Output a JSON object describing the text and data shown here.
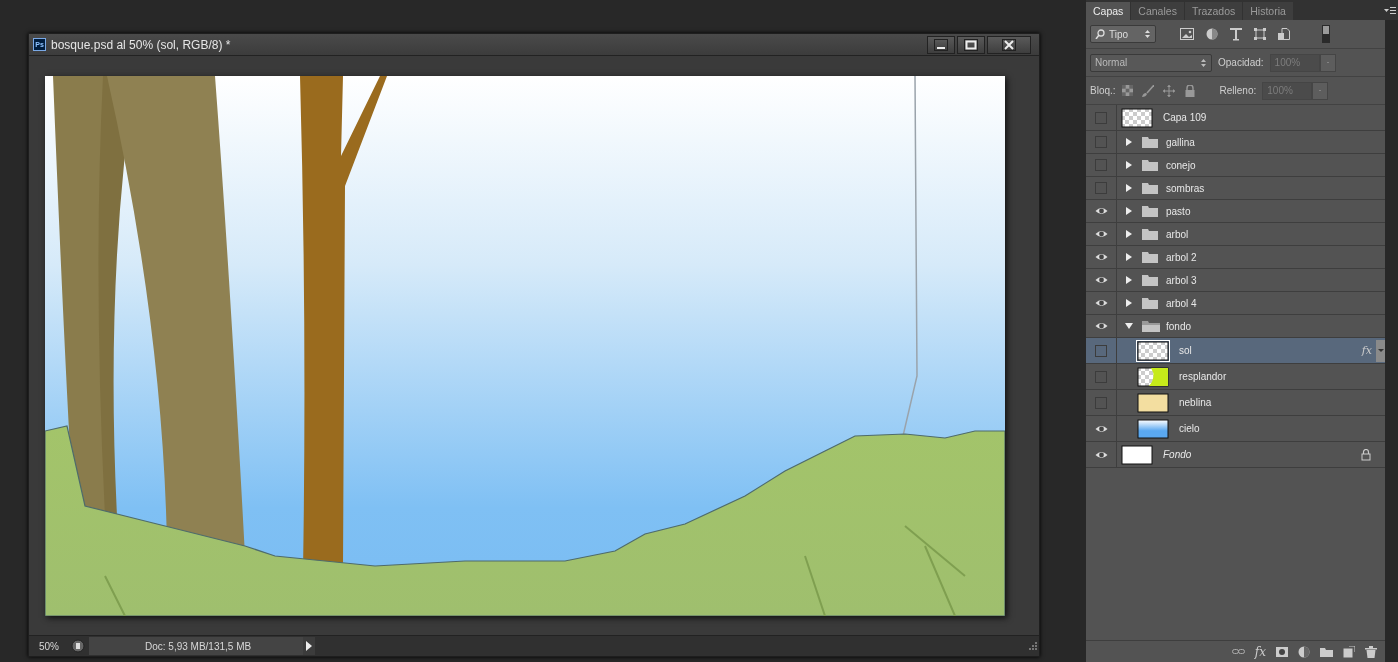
{
  "document": {
    "app_badge": "Ps",
    "title": "bosque.psd al 50% (sol, RGB/8) *",
    "zoom": "50%",
    "doc_info": "Doc: 5,93 MB/131,5 MB"
  },
  "layers_panel": {
    "tabs": [
      {
        "label": "Capas",
        "selected": true
      },
      {
        "label": "Canales",
        "selected": false
      },
      {
        "label": "Trazados",
        "selected": false
      },
      {
        "label": "Historia",
        "selected": false
      }
    ],
    "filter": {
      "label": "Tipo",
      "on": true
    },
    "blend_mode": "Normal",
    "opacity": {
      "label": "Opacidad:",
      "value": "100%",
      "disabled": true
    },
    "lock": {
      "label": "Bloq.:"
    },
    "fill": {
      "label": "Relleno:",
      "value": "100%",
      "disabled": true
    },
    "layers": [
      {
        "kind": "layer",
        "name": "Capa 109",
        "visible": false,
        "selected": false,
        "thumbnail": {
          "transparent": true
        }
      },
      {
        "kind": "group",
        "name": "gallina",
        "visible": false,
        "selected": false,
        "expanded": false
      },
      {
        "kind": "group",
        "name": "conejo",
        "visible": false,
        "selected": false,
        "expanded": false
      },
      {
        "kind": "group",
        "name": "sombras",
        "visible": false,
        "selected": false,
        "expanded": false
      },
      {
        "kind": "group",
        "name": "pasto",
        "visible": true,
        "selected": false,
        "expanded": false
      },
      {
        "kind": "group",
        "name": "arbol",
        "visible": true,
        "selected": false,
        "expanded": false
      },
      {
        "kind": "group",
        "name": "arbol 2",
        "visible": true,
        "selected": false,
        "expanded": false
      },
      {
        "kind": "group",
        "name": "arbol 3",
        "visible": true,
        "selected": false,
        "expanded": false
      },
      {
        "kind": "group",
        "name": "arbol 4",
        "visible": true,
        "selected": false,
        "expanded": false
      },
      {
        "kind": "group",
        "name": "fondo",
        "visible": true,
        "selected": false,
        "expanded": true,
        "children": [
          {
            "kind": "layer",
            "name": "sol",
            "visible": false,
            "selected": true,
            "thumbnail": {
              "transparent": true
            },
            "effects_badge": "fx"
          },
          {
            "kind": "layer",
            "name": "resplandor",
            "visible": false,
            "selected": false,
            "thumbnail": {
              "transparent": true,
              "color": "#c6ea1a"
            }
          },
          {
            "kind": "layer",
            "name": "neblina",
            "visible": false,
            "selected": false,
            "thumbnail": {
              "transparent": false,
              "color": "#f3dea0"
            }
          },
          {
            "kind": "layer",
            "name": "cielo",
            "visible": true,
            "selected": false,
            "thumbnail": {
              "transparent": false,
              "color": "#5aa8f0",
              "gradient": true
            }
          }
        ]
      },
      {
        "kind": "background",
        "name": "Fondo",
        "visible": true,
        "selected": false,
        "thumbnail": {
          "transparent": false,
          "color": "#ffffff"
        },
        "locked": true
      }
    ],
    "footer": {
      "effects_label": "fx"
    }
  }
}
